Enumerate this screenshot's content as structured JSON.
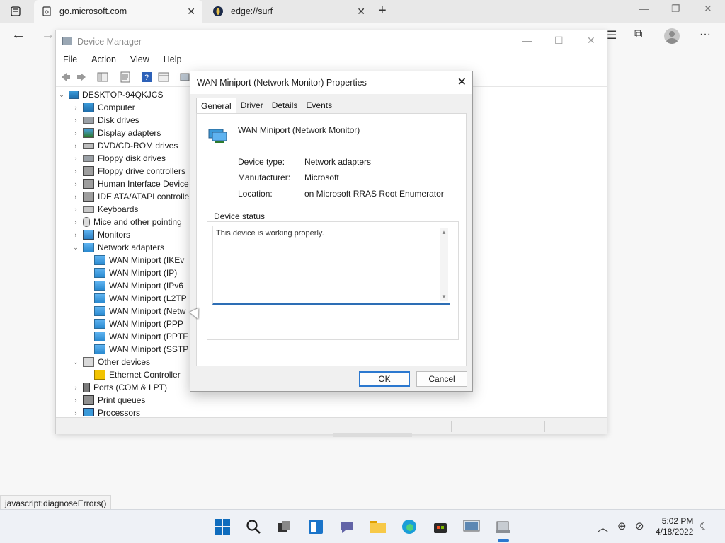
{
  "browser": {
    "tabs": [
      {
        "title": "go.microsoft.com",
        "active": true
      },
      {
        "title": "edge://surf",
        "active": false
      }
    ],
    "status_url": "javascript:diagnoseErrors()"
  },
  "device_manager": {
    "title": "Device Manager",
    "menu": [
      "File",
      "Action",
      "View",
      "Help"
    ],
    "tree": {
      "root": "DESKTOP-94QKJCS",
      "categories": [
        {
          "label": "Computer",
          "icon": "pc",
          "expanded": false
        },
        {
          "label": "Disk drives",
          "icon": "disk",
          "expanded": false
        },
        {
          "label": "Display adapters",
          "icon": "disp",
          "expanded": false
        },
        {
          "label": "DVD/CD-ROM drives",
          "icon": "dvd",
          "expanded": false
        },
        {
          "label": "Floppy disk drives",
          "icon": "disk",
          "expanded": false
        },
        {
          "label": "Floppy drive controllers",
          "icon": "hid",
          "expanded": false
        },
        {
          "label": "Human Interface Device",
          "icon": "hid",
          "expanded": false
        },
        {
          "label": "IDE ATA/ATAPI controlle",
          "icon": "hid",
          "expanded": false
        },
        {
          "label": "Keyboards",
          "icon": "kb",
          "expanded": false
        },
        {
          "label": "Mice and other pointing",
          "icon": "mouse",
          "expanded": false
        },
        {
          "label": "Monitors",
          "icon": "mon",
          "expanded": false
        },
        {
          "label": "Network adapters",
          "icon": "net",
          "expanded": true,
          "children": [
            "WAN Miniport (IKEv",
            "WAN Miniport (IP)",
            "WAN Miniport (IPv6",
            "WAN Miniport (L2TP",
            "WAN Miniport (Netw",
            "WAN Miniport (PPP",
            "WAN Miniport (PPTF",
            "WAN Miniport (SSTP"
          ]
        },
        {
          "label": "Other devices",
          "icon": "unk",
          "expanded": true,
          "children": [
            "Ethernet Controller"
          ]
        },
        {
          "label": "Ports (COM & LPT)",
          "icon": "port",
          "expanded": false
        },
        {
          "label": "Print queues",
          "icon": "print",
          "expanded": false
        },
        {
          "label": "Processors",
          "icon": "cpu",
          "expanded": false
        }
      ]
    }
  },
  "dialog": {
    "title": "WAN Miniport (Network Monitor) Properties",
    "tabs": [
      "General",
      "Driver",
      "Details",
      "Events"
    ],
    "selected_tab": "General",
    "device_name": "WAN Miniport (Network Monitor)",
    "device_type_label": "Device type:",
    "device_type": "Network adapters",
    "manufacturer_label": "Manufacturer:",
    "manufacturer": "Microsoft",
    "location_label": "Location:",
    "location": "on Microsoft RRAS Root Enumerator",
    "status_group": "Device status",
    "status_text": "This device is working properly.",
    "ok": "OK",
    "cancel": "Cancel"
  },
  "taskbar": {
    "time": "5:02 PM",
    "date": "4/18/2022"
  }
}
